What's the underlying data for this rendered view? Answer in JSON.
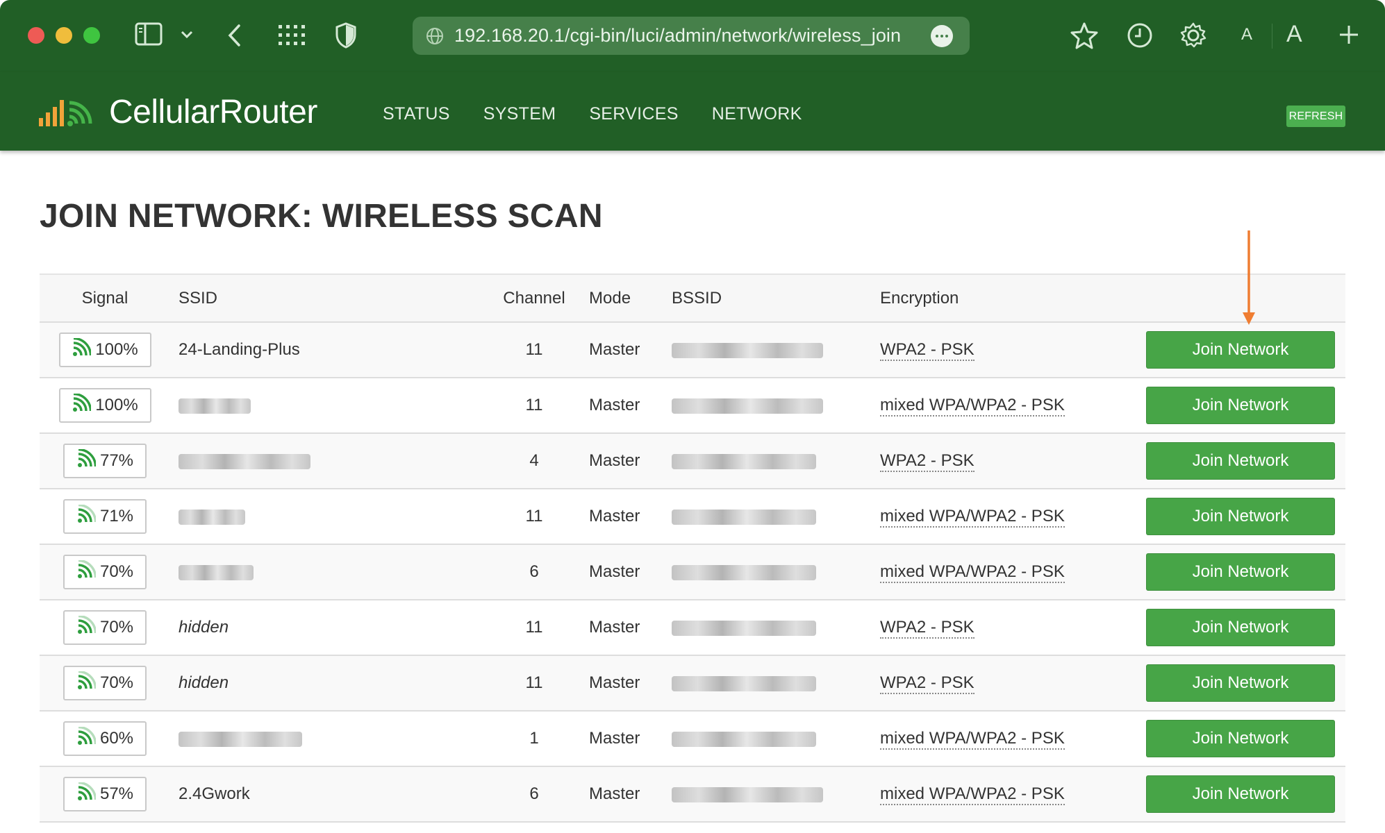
{
  "browser": {
    "url": "192.168.20.1/cgi-bin/luci/admin/network/wireless_join",
    "font_small_label": "A",
    "font_large_label": "A"
  },
  "app": {
    "brand": "CellularRouter",
    "nav": [
      "STATUS",
      "SYSTEM",
      "SERVICES",
      "NETWORK"
    ],
    "refresh_label": "REFRESH"
  },
  "page": {
    "title": "JOIN NETWORK: WIRELESS SCAN"
  },
  "table": {
    "headers": {
      "signal": "Signal",
      "ssid": "SSID",
      "channel": "Channel",
      "mode": "Mode",
      "bssid": "BSSID",
      "encryption": "Encryption"
    },
    "join_label": "Join Network",
    "rows": [
      {
        "signal": "100%",
        "ssid": "24-Landing-Plus",
        "channel": "11",
        "mode": "Master",
        "encryption": "WPA2 - PSK"
      },
      {
        "signal": "100%",
        "ssid": "",
        "channel": "11",
        "mode": "Master",
        "encryption": "mixed WPA/WPA2 - PSK"
      },
      {
        "signal": "77%",
        "ssid": "",
        "channel": "4",
        "mode": "Master",
        "encryption": "WPA2 - PSK"
      },
      {
        "signal": "71%",
        "ssid": "",
        "channel": "11",
        "mode": "Master",
        "encryption": "mixed WPA/WPA2 - PSK"
      },
      {
        "signal": "70%",
        "ssid": "",
        "channel": "6",
        "mode": "Master",
        "encryption": "mixed WPA/WPA2 - PSK"
      },
      {
        "signal": "70%",
        "ssid": "hidden",
        "channel": "11",
        "mode": "Master",
        "encryption": "WPA2 - PSK"
      },
      {
        "signal": "70%",
        "ssid": "hidden",
        "channel": "11",
        "mode": "Master",
        "encryption": "WPA2 - PSK"
      },
      {
        "signal": "60%",
        "ssid": "",
        "channel": "1",
        "mode": "Master",
        "encryption": "mixed WPA/WPA2 - PSK"
      },
      {
        "signal": "57%",
        "ssid": "2.4Gwork",
        "channel": "6",
        "mode": "Master",
        "encryption": "mixed WPA/WPA2 - PSK"
      }
    ]
  },
  "colors": {
    "header_green": "#215f26",
    "button_green": "#47a547",
    "signal_icon_green": "#2e9e3e",
    "annotation_arrow": "#ef7d32"
  }
}
